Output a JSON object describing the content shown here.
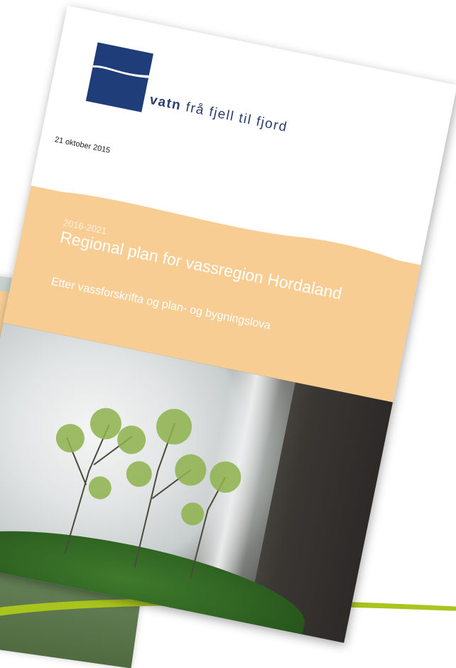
{
  "logo": {
    "brand_bold": "vatn",
    "brand_tagline": " frå fjell til fjord"
  },
  "document": {
    "date": "21 oktober 2015",
    "years": "2016-2021",
    "title": "Regional plan for vassregion Hordaland",
    "subtitle": "Etter vassforskrifta og plan- og bygningslova"
  },
  "colors": {
    "logo_blue": "#1f3d78",
    "band_peach": "#f8cd93",
    "swoosh_green": "#a9c41c"
  },
  "images": {
    "cover_photo": "waterfall-with-birch-trees",
    "back_cover_photo": "misty-forest"
  }
}
